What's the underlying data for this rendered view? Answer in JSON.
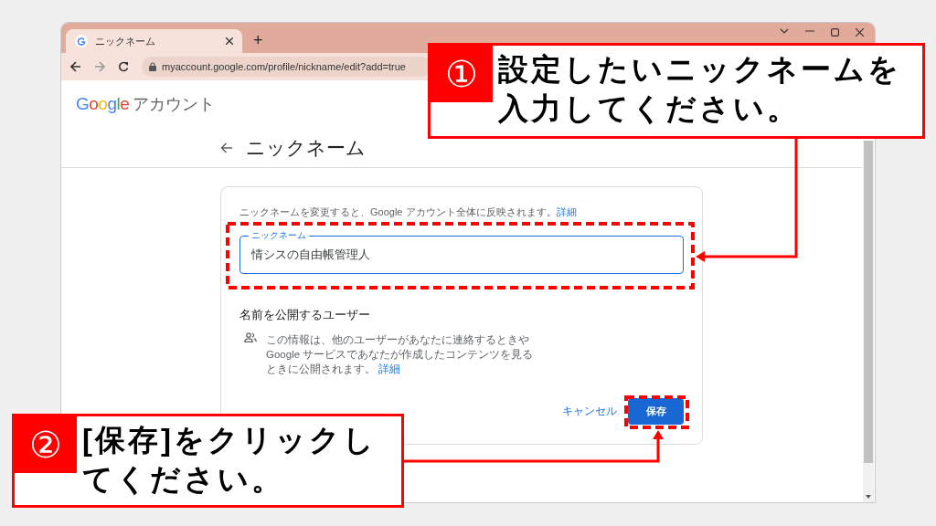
{
  "browser": {
    "tab_title": "ニックネーム",
    "new_tab": "+",
    "url": "myaccount.google.com/profile/nickname/edit?add=true"
  },
  "header": {
    "logo": "Google",
    "product": "アカウント"
  },
  "page_title": "ニックネーム",
  "card": {
    "intro": "ニックネームを変更すると、Google アカウント全体に反映されます。",
    "intro_link": "詳細",
    "field": {
      "label": "ニックネーム",
      "value": "情シスの自由帳管理人"
    },
    "section_title": "名前を公開するユーザー",
    "section_text": "この情報は、他のユーザーがあなたに連絡するときや Google サービスであなたが作成したコンテンツを見るときに公開されます。",
    "section_link": "詳細",
    "buttons": [
      {
        "label": "キャンセル",
        "kind": "text"
      },
      {
        "label": "保存",
        "kind": "filled"
      }
    ]
  },
  "callouts": [
    {
      "number": "①",
      "text": "設定したいニックネームを入力してください。"
    },
    {
      "number": "②",
      "text": "[保存]をクリックしてください。"
    }
  ]
}
